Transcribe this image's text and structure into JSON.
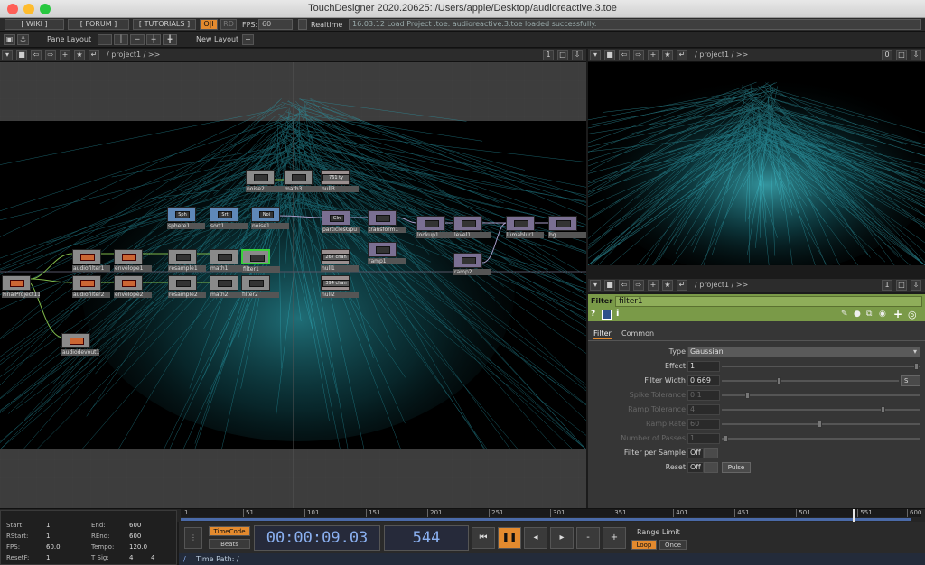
{
  "window": {
    "title": "TouchDesigner 2020.20625: /Users/apple/Desktop/audioreactive.3.toe"
  },
  "menubar": {
    "wiki": "[ WIKI ]",
    "forum": "[ FORUM ]",
    "tutorials": "[ TUTORIALS ]",
    "oi": "O|I",
    "rd": "RD",
    "fps": "FPS:",
    "fps_value": "60",
    "realtime": "Realtime",
    "status": "16:03:12 Load Project .toe: audioreactive.3.toe loaded successfully."
  },
  "toolbar": {
    "pane_layout": "Pane Layout",
    "new_layout": "New Layout",
    "plus": "+"
  },
  "network_pane": {
    "path": "/ project1 / >>",
    "count": "1"
  },
  "viewer_pane": {
    "path": "/ project1 / >>",
    "count": "0"
  },
  "param_pane": {
    "path": "/ project1 / >>",
    "count": "1"
  },
  "nodes": [
    {
      "name": "noise2",
      "inner": ""
    },
    {
      "name": "math3",
      "inner": ""
    },
    {
      "name": "null3",
      "inner": "761 ty"
    },
    {
      "name": "sphere1",
      "inner": "Sph"
    },
    {
      "name": "sort1",
      "inner": "Srt"
    },
    {
      "name": "noise1",
      "inner": "Noi"
    },
    {
      "name": "particlesGpu",
      "inner": "Gln"
    },
    {
      "name": "transform1",
      "inner": ""
    },
    {
      "name": "lookup1",
      "inner": ""
    },
    {
      "name": "level1",
      "inner": ""
    },
    {
      "name": "lumablur1",
      "inner": ""
    },
    {
      "name": "bg",
      "inner": ""
    },
    {
      "name": "audiofilter1",
      "inner": ""
    },
    {
      "name": "envelope1",
      "inner": ""
    },
    {
      "name": "resample1",
      "inner": ""
    },
    {
      "name": "math1",
      "inner": ""
    },
    {
      "name": "filter1",
      "inner": ""
    },
    {
      "name": "null1",
      "inner": "267 chan"
    },
    {
      "name": "ramp1",
      "inner": ""
    },
    {
      "name": "ramp2",
      "inner": ""
    },
    {
      "name": "FinalProject111",
      "inner": ""
    },
    {
      "name": "audiofilter2",
      "inner": ""
    },
    {
      "name": "envelope2",
      "inner": ""
    },
    {
      "name": "resample2",
      "inner": ""
    },
    {
      "name": "math2",
      "inner": ""
    },
    {
      "name": "filter2",
      "inner": ""
    },
    {
      "name": "null2",
      "inner": "394 chan"
    },
    {
      "name": "audiodevout1",
      "inner": ""
    }
  ],
  "params": {
    "op_type": "Filter",
    "op_name": "filter1",
    "tabs": [
      "Filter",
      "Common"
    ],
    "rows": [
      {
        "label": "Type",
        "value": "Gaussian"
      },
      {
        "label": "Effect",
        "value": "1"
      },
      {
        "label": "Filter Width",
        "value": "0.669",
        "unit": "S"
      },
      {
        "label": "Spike Tolerance",
        "value": "0.1"
      },
      {
        "label": "Ramp Tolerance",
        "value": "4"
      },
      {
        "label": "Ramp Rate",
        "value": "60"
      },
      {
        "label": "Number of Passes",
        "value": "1"
      },
      {
        "label": "Filter per Sample",
        "value": "Off"
      },
      {
        "label": "Reset",
        "value": "Off",
        "extra": "Pulse"
      }
    ]
  },
  "timeline": {
    "ticks": [
      "1",
      "51",
      "101",
      "151",
      "201",
      "251",
      "301",
      "351",
      "401",
      "451",
      "501",
      "551",
      "600"
    ],
    "stats": {
      "start_l": "Start:",
      "start_v": "1",
      "end_l": "End:",
      "end_v": "600",
      "rstart_l": "RStart:",
      "rstart_v": "1",
      "rend_l": "REnd:",
      "rend_v": "600",
      "fps_l": "FPS:",
      "fps_v": "60.0",
      "tempo_l": "Tempo:",
      "tempo_v": "120.0",
      "resetf_l": "ResetF:",
      "resetf_v": "1",
      "tsig_l": "T Sig:",
      "tsig_v1": "4",
      "tsig_v2": "4"
    },
    "timecode_btn": "TimeCode",
    "beats_btn": "Beats",
    "timecode": "00:00:09.03",
    "frame": "544",
    "range_limit": "Range Limit",
    "loop": "Loop",
    "once": "Once",
    "time_path": "Time Path: /",
    "slash": "/"
  },
  "colors": {
    "accent": "#e38a2e",
    "param_header": "#7a9a48",
    "particles": "#36c6d6",
    "timecode": "#8ab0f0"
  }
}
